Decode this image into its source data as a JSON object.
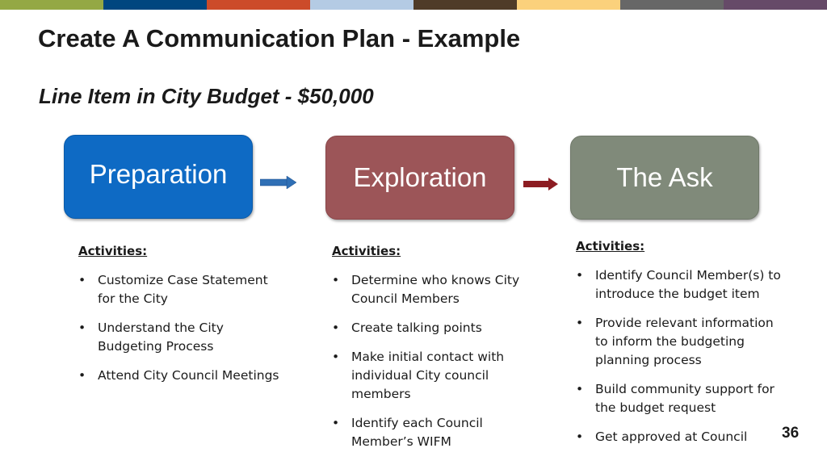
{
  "top_bar_colors": [
    "#94a844",
    "#00467f",
    "#cc4b2a",
    "#b4cbe4",
    "#4f3b28",
    "#fbd17c",
    "#676767",
    "#664a68"
  ],
  "title": "Create A Communication Plan - Example",
  "subtitle": "Line Item in City Budget - $50,000",
  "stages": [
    {
      "label": "Preparation",
      "color": "#0e6ac4"
    },
    {
      "label": "Exploration",
      "color": "#9c5558"
    },
    {
      "label": "The Ask",
      "color": "#808a7a"
    }
  ],
  "arrows": [
    {
      "icon": "right-arrow-icon",
      "color": "#2f6fb5"
    },
    {
      "icon": "right-arrow-icon",
      "color": "#8c1c22"
    }
  ],
  "columns": [
    {
      "header": "Activities:",
      "items": [
        "Customize Case Statement for the City",
        "Understand the City Budgeting Process",
        "Attend City Council Meetings"
      ]
    },
    {
      "header": "Activities:",
      "items": [
        "Determine who knows City Council Members",
        "Create talking points",
        "Make initial contact with individual City council members",
        "Identify each Council Member’s WIFM"
      ]
    },
    {
      "header": "Activities:",
      "items": [
        "Identify Council Member(s) to introduce the budget item",
        "Provide relevant information to inform the budgeting planning process",
        "Build community support for the budget request",
        "Get approved at Council"
      ]
    }
  ],
  "bullet_char": "•",
  "page_number": "36"
}
